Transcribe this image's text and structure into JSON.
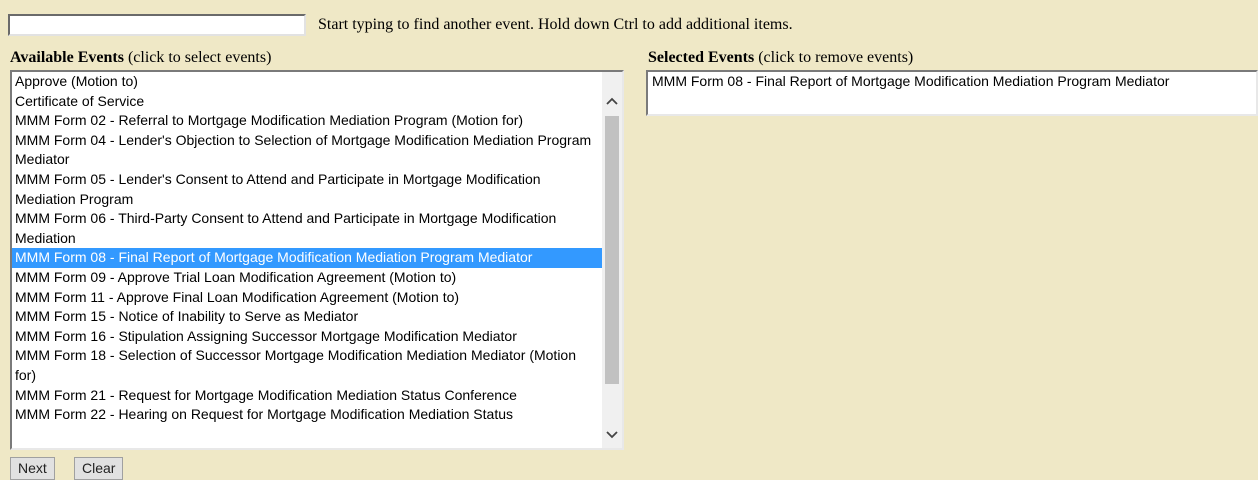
{
  "search": {
    "value": "",
    "placeholder": ""
  },
  "hint": "Start typing to find another event. Hold down Ctrl to add additional items.",
  "available": {
    "heading_bold": "Available Events",
    "heading_note": "(click to select events)",
    "items": [
      "Approve (Motion to)",
      "Certificate of Service",
      "MMM Form 02 - Referral to Mortgage Modification Mediation Program (Motion for)",
      "MMM Form 04 - Lender's Objection to Selection of Mortgage Modification Mediation Program Mediator",
      "MMM Form 05 - Lender's Consent to Attend and Participate in Mortgage Modification Mediation Program",
      "MMM Form 06 - Third-Party Consent to Attend and Participate in Mortgage Modification Mediation",
      "MMM Form 08 - Final Report of Mortgage Modification Mediation Program Mediator",
      "MMM Form 09 - Approve Trial Loan Modification Agreement (Motion to)",
      "MMM Form 11 - Approve Final Loan Modification Agreement (Motion to)",
      "MMM Form 15 - Notice of Inability to Serve as Mediator",
      "MMM Form 16 - Stipulation Assigning Successor Mortgage Modification Mediator",
      "MMM Form 18 - Selection of Successor Mortgage Modification Mediation Mediator (Motion for)",
      "MMM Form 21 - Request for Mortgage Modification Mediation Status Conference",
      "MMM Form 22 - Hearing on Request for Mortgage Modification Mediation Status"
    ],
    "selected_index": 6
  },
  "selected": {
    "heading_bold": "Selected Events",
    "heading_note": "(click to remove events)",
    "items": [
      "MMM Form 08 - Final Report of Mortgage Modification Mediation Program Mediator"
    ]
  },
  "buttons": {
    "next": "Next",
    "clear": "Clear"
  },
  "colors": {
    "page_background": "#efe8c6",
    "selection_highlight": "#3399ff"
  },
  "icons": {
    "scroll_up": "chevron-up-icon",
    "scroll_down": "chevron-down-icon"
  }
}
